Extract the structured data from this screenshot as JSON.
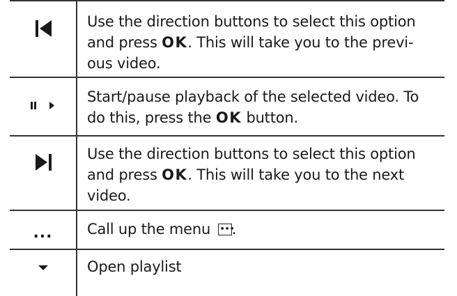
{
  "rows": [
    {
      "icon": "skip-previous-icon",
      "text_before": "Use the direction buttons to select this option and press ",
      "key": "OK",
      "text_after": ". This will take you to the previ-ous video."
    },
    {
      "icon": "play-pause-icon",
      "text_before": "Start/pause playback of the selected video. To do this, press the ",
      "key": "OK",
      "text_after": " button."
    },
    {
      "icon": "skip-next-icon",
      "text_before": "Use the direction buttons to select this option and press ",
      "key": "OK",
      "text_after": ". This will take you to the next video."
    },
    {
      "icon": "more-dots-icon",
      "symbol": "...",
      "text_before": "Call up the menu ",
      "menu_icon_glyph": "•••",
      "text_after": "."
    },
    {
      "icon": "dropdown-arrow-icon",
      "text_before": "Open playlist"
    }
  ]
}
